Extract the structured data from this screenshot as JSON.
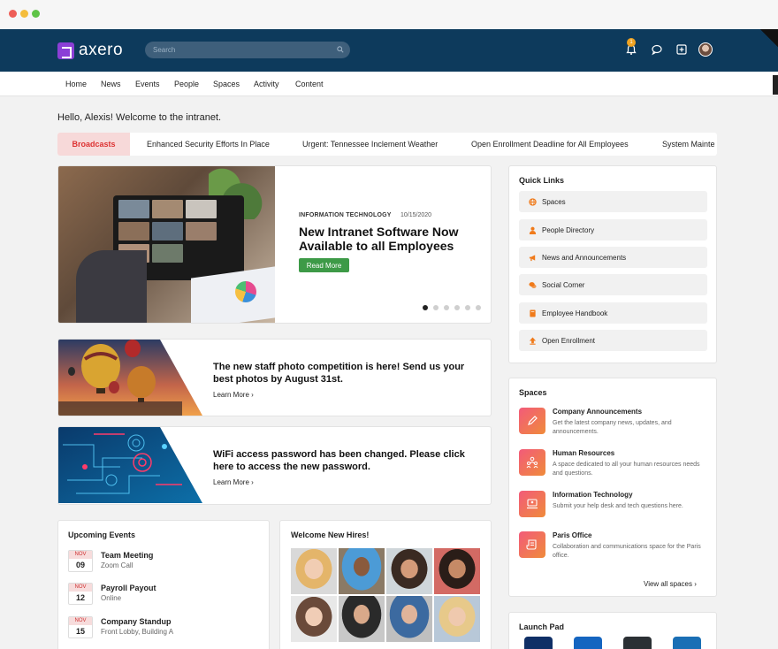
{
  "app": {
    "brand": "axero",
    "search_placeholder": "Search",
    "notification_count": "1",
    "colors": {
      "header": "#0d3a5c",
      "accent": "#f07a1a",
      "primary_button": "#3d9a47"
    }
  },
  "nav": [
    "Home",
    "News",
    "Events",
    "People",
    "Spaces",
    "Activity",
    "Content"
  ],
  "greeting": "Hello, Alexis! Welcome to the intranet.",
  "broadcasts": {
    "label": "Broadcasts",
    "items": [
      "Enhanced Security Efforts In Place",
      "Urgent: Tennessee Inclement Weather",
      "Open Enrollment Deadline for All Employees",
      "System Mainte"
    ]
  },
  "hero": {
    "category": "INFORMATION TECHNOLOGY",
    "date": "10/15/2020",
    "title": "New Intranet Software Now Available to all Employees",
    "button": "Read More"
  },
  "promos": [
    {
      "title": "The new staff photo competition is here! Send us your best photos by August 31st.",
      "link": "Learn More ›"
    },
    {
      "title": "WiFi access password has been changed. Please click here to access the new password.",
      "link": "Learn More ›"
    }
  ],
  "quick_links": {
    "title": "Quick Links",
    "items": [
      {
        "label": "Spaces",
        "icon": "globe-icon"
      },
      {
        "label": "People Directory",
        "icon": "person-icon"
      },
      {
        "label": "News and Announcements",
        "icon": "megaphone-icon"
      },
      {
        "label": "Social Corner",
        "icon": "chat-icon"
      },
      {
        "label": "Employee Handbook",
        "icon": "book-icon"
      },
      {
        "label": "Open Enrollment",
        "icon": "upload-icon"
      }
    ]
  },
  "spaces": {
    "title": "Spaces",
    "items": [
      {
        "name": "Company Announcements",
        "desc": "Get the latest company news, updates, and announcements."
      },
      {
        "name": "Human Resources",
        "desc": "A space dedicated to all your human resources needs and questions."
      },
      {
        "name": "Information Technology",
        "desc": "Submit your help desk and tech questions here."
      },
      {
        "name": "Paris Office",
        "desc": "Collaboration and communications space for the Paris office."
      }
    ],
    "view_all": "View all spaces ›"
  },
  "events": {
    "title": "Upcoming Events",
    "items": [
      {
        "month": "NOV",
        "day": "09",
        "name": "Team Meeting",
        "location": "Zoom Call"
      },
      {
        "month": "NOV",
        "day": "12",
        "name": "Payroll Payout",
        "location": "Online"
      },
      {
        "month": "NOV",
        "day": "15",
        "name": "Company Standup",
        "location": "Front Lobby, Building A"
      }
    ]
  },
  "hires": {
    "title": "Welcome New Hires!"
  },
  "launch_pad": {
    "title": "Launch Pad"
  }
}
